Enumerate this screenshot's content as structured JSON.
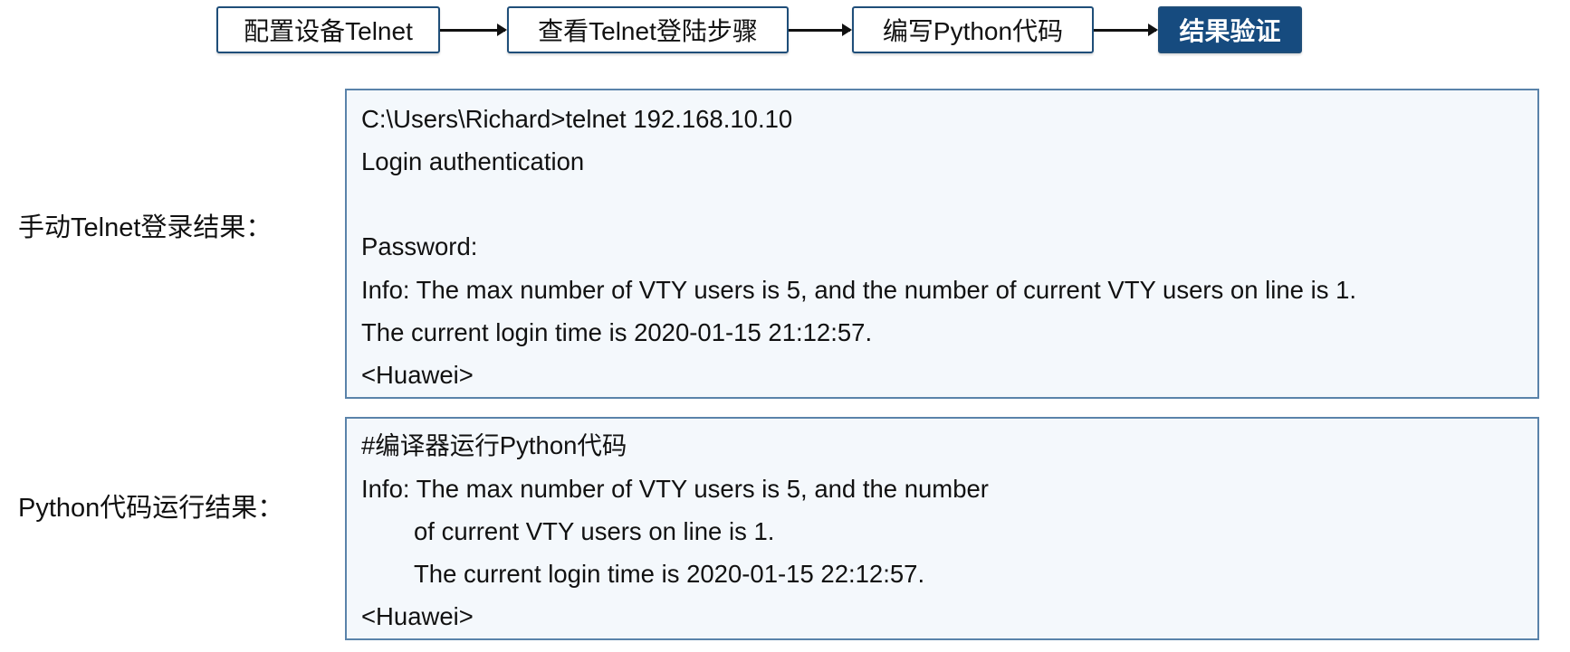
{
  "flow": {
    "steps": [
      "配置设备Telnet",
      "查看Telnet登陆步骤",
      "编写Python代码",
      "结果验证"
    ],
    "active_step": 3,
    "colors": {
      "border": "#1f4e79",
      "active_fill": "#164b7f"
    }
  },
  "manual": {
    "label": "手动Telnet登录结果：",
    "lines": [
      "C:\\Users\\Richard>telnet 192.168.10.10",
      "Login authentication",
      "",
      "Password:",
      "Info: The max number of VTY users is 5, and the number of current VTY users on line is 1.",
      "The current login time is 2020-01-15 21:12:57.",
      "<Huawei>"
    ]
  },
  "python": {
    "label": "Python代码运行结果：",
    "lines": [
      "#编译器运行Python代码",
      "Info: The max number of VTY users is 5, and the number",
      "of current VTY users on line is 1.",
      "The current login time is 2020-01-15 22:12:57.",
      "<Huawei>"
    ]
  }
}
